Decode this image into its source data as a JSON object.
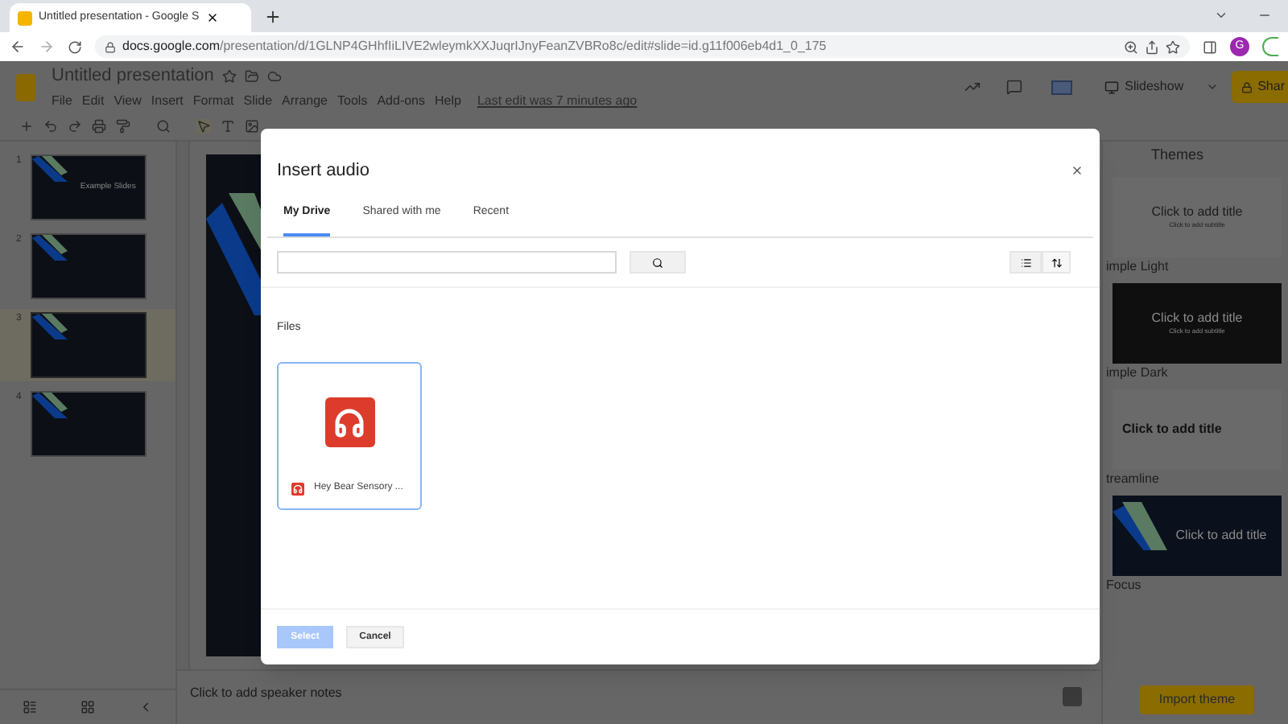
{
  "browser": {
    "tab_title": "Untitled presentation - Google S",
    "url_host": "docs.google.com",
    "url_path": "/presentation/d/1GLNP4GHhfIiLIVE2wleymkXXJuqrIJnyFeanZVBRo8c/edit#slide=id.g11f006eb4d1_0_175",
    "profile_initial": "G"
  },
  "app": {
    "title": "Untitled presentation",
    "menu": [
      "File",
      "Edit",
      "View",
      "Insert",
      "Format",
      "Slide",
      "Arrange",
      "Tools",
      "Add-ons",
      "Help"
    ],
    "last_edit": "Last edit was 7 minutes ago",
    "slideshow_button": "Slideshow",
    "share_button": "Shar"
  },
  "filmstrip": {
    "slides": [
      {
        "number": "1",
        "title": "Example Slides",
        "selected": false
      },
      {
        "number": "2",
        "selected": false
      },
      {
        "number": "3",
        "selected": true
      },
      {
        "number": "4",
        "selected": false
      }
    ]
  },
  "speaker_notes": {
    "placeholder": "Click to add speaker notes"
  },
  "themes": {
    "title": "Themes",
    "items": [
      {
        "kind": "light",
        "name": "imple Light",
        "title": "Click to add title",
        "subtitle": "Click to add subtitle"
      },
      {
        "kind": "dark",
        "name": "imple Dark",
        "title": "Click to add title",
        "subtitle": "Click to add subtitle"
      },
      {
        "kind": "streamline",
        "name": "treamline",
        "title": "Click to add title"
      },
      {
        "kind": "focus",
        "name": "Focus",
        "title": "Click to add title"
      }
    ],
    "import_button": "Import theme"
  },
  "dialog": {
    "title": "Insert audio",
    "tabs": [
      {
        "label": "My Drive",
        "selected": true
      },
      {
        "label": "Shared with me",
        "selected": false
      },
      {
        "label": "Recent",
        "selected": false
      }
    ],
    "section": "Files",
    "files": [
      {
        "name": "Hey Bear Sensory ...",
        "selected": true
      }
    ],
    "select_button": {
      "label": "Select",
      "disabled": true
    },
    "cancel_button": "Cancel"
  }
}
